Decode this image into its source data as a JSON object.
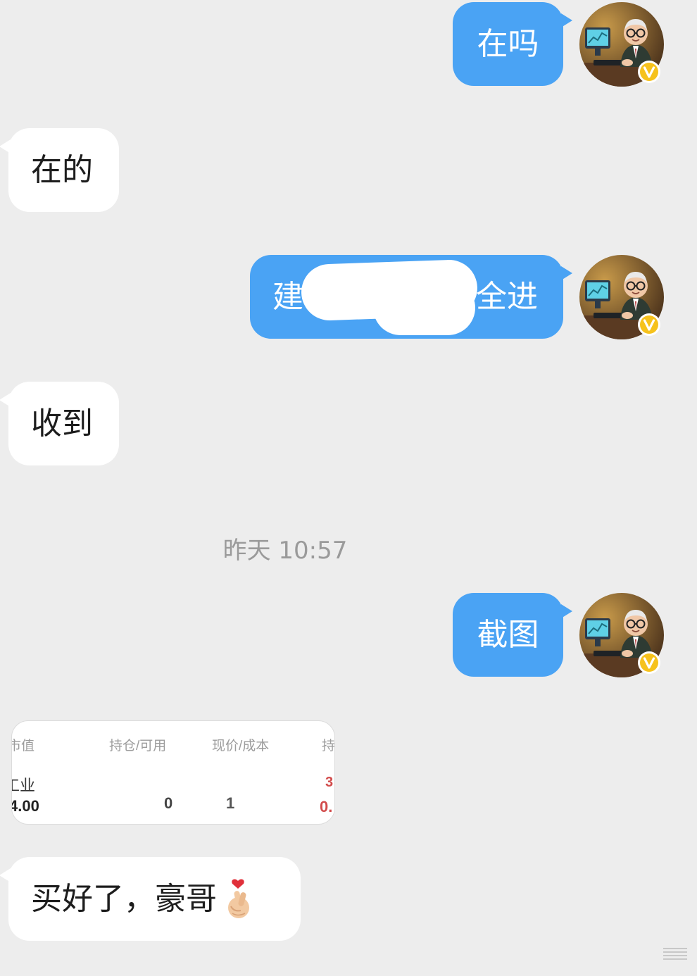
{
  "messages": [
    {
      "text": "在吗"
    },
    {
      "text": "在的"
    },
    {
      "text_start": "建",
      "text_end": "全进"
    },
    {
      "text": "收到"
    },
    {
      "text": "截图"
    },
    {
      "text": "买好了，豪哥",
      "emoji": "🫰"
    }
  ],
  "timestamp": "昨天 10:57",
  "screenshot": {
    "headers": [
      "市值",
      "持仓/可用",
      "现价/成本",
      "持"
    ],
    "stock_name": "工业",
    "row_values": [
      "4.00",
      "0",
      "1",
      "0.",
      "3"
    ]
  },
  "avatar": {
    "badge": "V",
    "icon": "verified-badge-icon"
  },
  "colors": {
    "outgoing_bubble": "#4aa3f4",
    "incoming_bubble": "#ffffff",
    "background": "#ededed",
    "badge": "#f6c21c"
  }
}
